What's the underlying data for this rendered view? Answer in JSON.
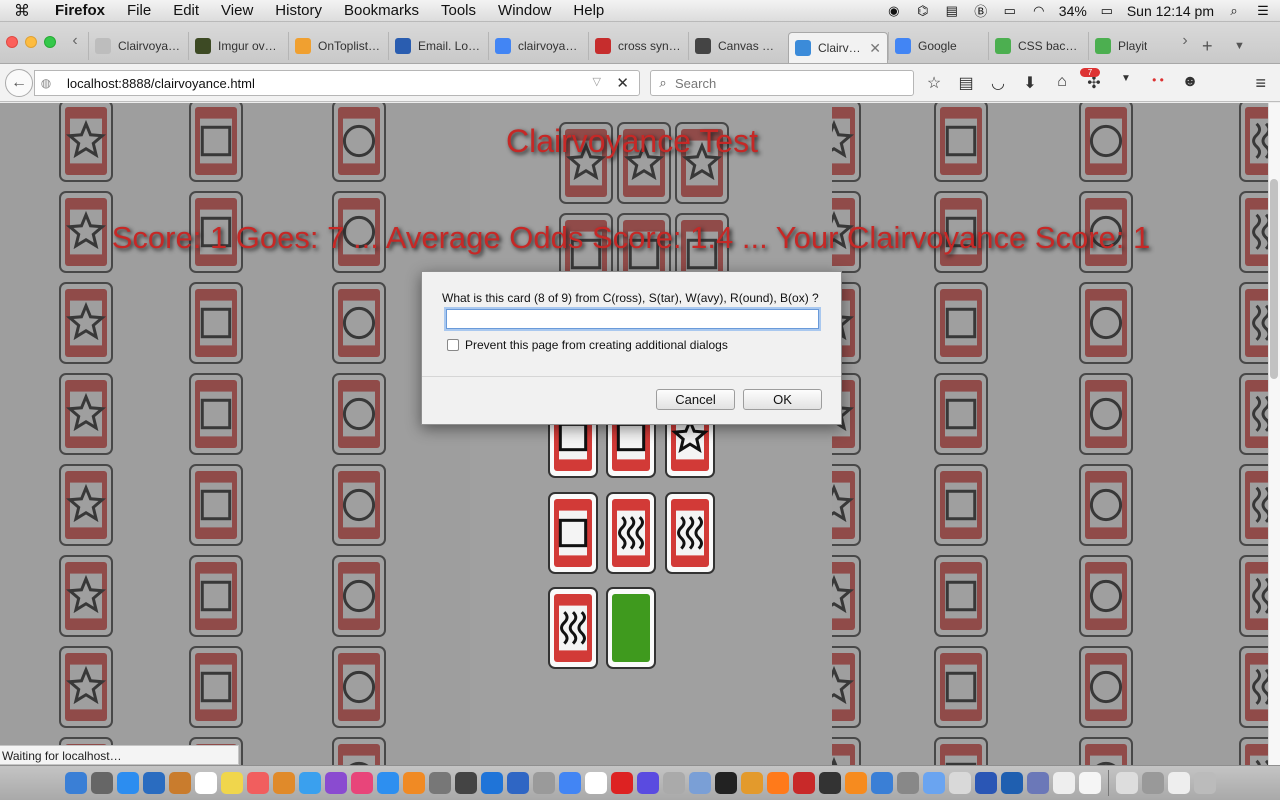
{
  "menubar": {
    "app_name": "Firefox",
    "items": [
      "File",
      "Edit",
      "View",
      "History",
      "Bookmarks",
      "Tools",
      "Window",
      "Help"
    ],
    "battery": "34%",
    "clock": "Sun 12:14 pm"
  },
  "tabs": [
    {
      "label": "Clairvoya…",
      "favicon": "page-icon",
      "color": "#bdbdbd"
    },
    {
      "label": "Imgur ov…",
      "favicon": "imgur-icon",
      "color": "#3d4a24"
    },
    {
      "label": "OnToplist…",
      "favicon": "ontoplist-icon",
      "color": "#f0a030"
    },
    {
      "label": "Email. Lo…",
      "favicon": "mail-icon",
      "color": "#2a5db0"
    },
    {
      "label": "clairvoya…",
      "favicon": "google-icon",
      "color": "#4285f4"
    },
    {
      "label": "cross syn…",
      "favicon": "crosswalk-icon",
      "color": "#c62d2d"
    },
    {
      "label": "Canvas H…",
      "favicon": "github-icon",
      "color": "#444444"
    },
    {
      "label": "Clairv…",
      "favicon": "loading-icon",
      "color": "#3b8bd9",
      "active": true
    },
    {
      "label": "Google",
      "favicon": "google-icon",
      "color": "#4285f4"
    },
    {
      "label": "CSS bac…",
      "favicon": "w3schools-icon",
      "color": "#4caf50"
    },
    {
      "label": "Playit",
      "favicon": "w3schools-icon",
      "color": "#4caf50"
    }
  ],
  "navbar": {
    "url": "localhost:8888/clairvoyance.html",
    "search_placeholder": "Search",
    "notification_count": "7"
  },
  "page": {
    "title": "Clairvoyance Test",
    "score_line": "Score: 1 Goes: 7 ... Average Odds Score: 1.4 ... Your Clairvoyance Score: 1"
  },
  "dialog": {
    "message": "What is this card (8 of 9) from C(ross), S(tar), W(avy), R(ound), B(ox) ?",
    "input_value": "",
    "checkbox_label": "Prevent this page from creating additional dialogs",
    "cancel_label": "Cancel",
    "ok_label": "OK"
  },
  "background_columns": [
    "star",
    "box",
    "round",
    "star",
    "round",
    "star",
    "box",
    "round",
    "wavy"
  ],
  "dealt_cards": [
    "box",
    "box",
    "star",
    "box",
    "wavy",
    "wavy",
    "wavy",
    "green"
  ],
  "colors": {
    "title_red": "#c62826",
    "card_red": "#d23a37",
    "card_green": "#3f9a1e"
  },
  "status": {
    "text": "Waiting for localhost…"
  },
  "dock": {
    "icons": [
      "finder-icon",
      "launchpad-icon",
      "safari-icon",
      "preview-icon",
      "books-icon",
      "calendar-icon",
      "notes-icon",
      "photos-icon",
      "photos2-icon",
      "messages-icon",
      "puzzle-icon",
      "itunes-icon",
      "appstore-icon",
      "ibooks-icon",
      "sysprefs-icon",
      "mic-icon",
      "xcode-icon",
      "wireshark-icon",
      "scripteditor-icon",
      "chrome-icon",
      "files-icon",
      "opera-icon",
      "imovie-icon",
      "stamp-icon",
      "mail2-icon",
      "terminal-icon",
      "tools-icon",
      "firefox-icon",
      "filezilla-icon",
      "search2-icon",
      "vlc-icon",
      "display-icon",
      "help-icon",
      "box-icon",
      "reader-icon",
      "bbedit-icon",
      "virtualbox-icon",
      "php-icon",
      "script-icon",
      "doc-icon",
      "finder2-icon",
      "drive-icon",
      "screen-icon",
      "trash-icon"
    ]
  }
}
